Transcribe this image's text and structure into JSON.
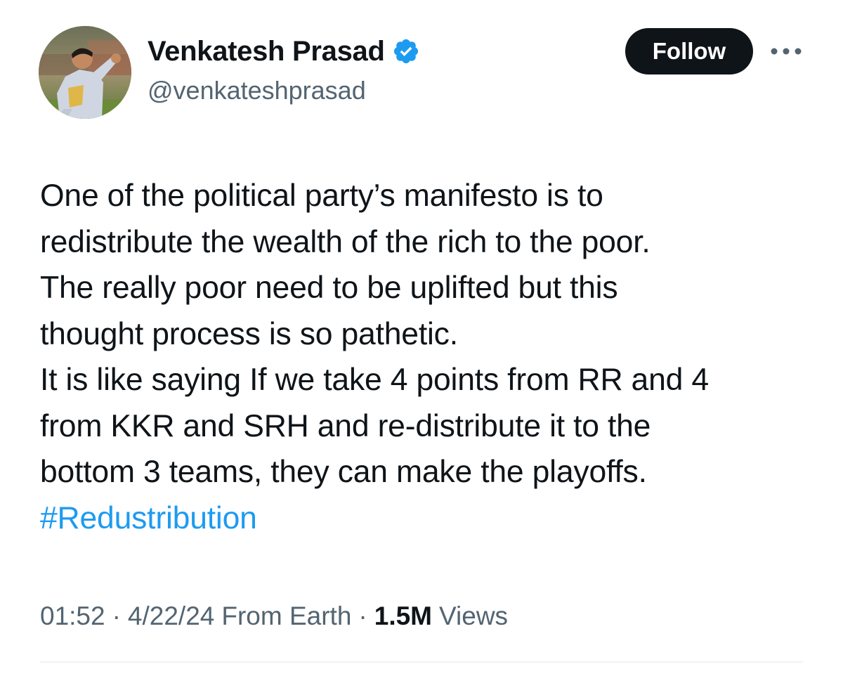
{
  "author": {
    "display_name": "Venkatesh Prasad",
    "handle": "@venkateshprasad",
    "verified": true
  },
  "actions": {
    "follow_label": "Follow",
    "more_icon": "more-horizontal-icon"
  },
  "tweet": {
    "lines": [
      "One of the political party’s manifesto is to",
      "redistribute the wealth of the rich to the poor.",
      "The really poor need to be uplifted but this",
      "thought process is so pathetic.",
      "It is like saying If we take 4 points from RR and 4",
      "from KKR and SRH and re-distribute it to the",
      "bottom 3 teams, they can make the playoffs."
    ],
    "hashtag": "#Redustribution"
  },
  "meta": {
    "time": "01:52",
    "separator": "·",
    "date": "4/22/24",
    "source": "From Earth",
    "views_count": "1.5M",
    "views_label": "Views"
  },
  "colors": {
    "text_primary": "#0f1419",
    "text_secondary": "#536471",
    "link": "#1d9bf0",
    "verified_badge": "#1d9bf0",
    "follow_bg": "#0f1419"
  }
}
